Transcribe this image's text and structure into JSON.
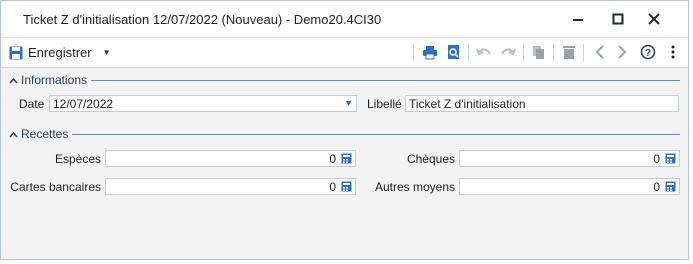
{
  "window": {
    "title": "Ticket Z d'initialisation 12/07/2022 (Nouveau) - Demo20.4CI30"
  },
  "toolbar": {
    "save_label": "Enregistrer"
  },
  "informations": {
    "title": "Informations",
    "date_label": "Date",
    "date_value": "12/07/2022",
    "libelle_label": "Libellé",
    "libelle_value": "Ticket Z d'initialisation"
  },
  "recettes": {
    "title": "Recettes",
    "especes_label": "Espèces",
    "especes_value": "0",
    "cheques_label": "Chèques",
    "cheques_value": "0",
    "cartes_label": "Cartes bancaires",
    "cartes_value": "0",
    "autres_label": "Autres moyens",
    "autres_value": "0"
  },
  "colors": {
    "accent": "#2f6fc8",
    "section_line": "#5b8ed6",
    "background": "#f3f3f3"
  }
}
